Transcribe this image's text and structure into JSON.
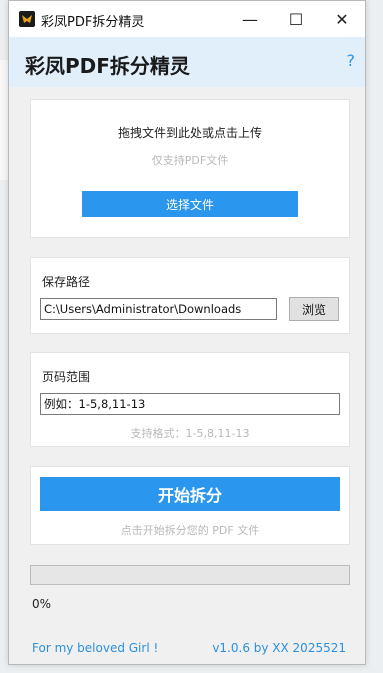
{
  "window": {
    "title": "彩凤PDF拆分精灵",
    "minimize_glyph": "—",
    "maximize_glyph": "☐",
    "close_glyph": "✕"
  },
  "header": {
    "app_title": "彩凤PDF拆分精灵",
    "help_glyph": "?"
  },
  "upload": {
    "prompt": "拖拽文件到此处或点击上传",
    "hint": "仅支持PDF文件",
    "select_button": "选择文件"
  },
  "save_path": {
    "label": "保存路径",
    "value": "C:\\Users\\Administrator\\Downloads",
    "browse_button": "浏览"
  },
  "page_range": {
    "label": "页码范围",
    "value": "例如：1-5,8,11-13",
    "format_hint": "支持格式：1-5,8,11-13"
  },
  "action": {
    "start_button": "开始拆分",
    "hint": "点击开始拆分您的 PDF 文件"
  },
  "progress": {
    "value": 0,
    "text": "0%"
  },
  "footer": {
    "left": "For my beloved Girl !",
    "right": "v1.0.6 by XX 2025521"
  },
  "colors": {
    "accent": "#2a96ee",
    "header_band": "#e1effa",
    "link": "#2b8fe0"
  }
}
